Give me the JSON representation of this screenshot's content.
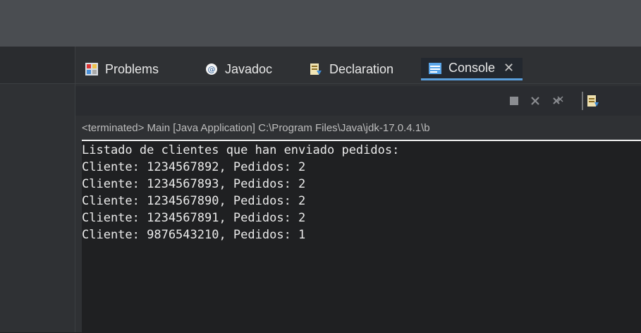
{
  "window": {
    "top_bar_color": "#4a4d51"
  },
  "tabs": [
    {
      "label": "Problems",
      "icon": "problems-icon"
    },
    {
      "label": "Javadoc",
      "icon": "javadoc-icon"
    },
    {
      "label": "Declaration",
      "icon": "declaration-icon"
    },
    {
      "label": "Console",
      "icon": "console-icon",
      "active": true,
      "close_label": "✕"
    }
  ],
  "toolbar": {
    "buttons": [
      "terminate-icon",
      "remove-icon",
      "remove-all-icon",
      "view-menu-icon"
    ]
  },
  "console": {
    "status": "<terminated> Main [Java Application] C:\\Program Files\\Java\\jdk-17.0.4.1\\b",
    "lines": [
      "Listado de clientes que han enviado pedidos:",
      "Cliente: 1234567892, Pedidos: 2",
      "Cliente: 1234567893, Pedidos: 2",
      "Cliente: 1234567890, Pedidos: 2",
      "Cliente: 1234567891, Pedidos: 2",
      "Cliente: 9876543210, Pedidos: 1"
    ]
  },
  "colors": {
    "background": "#1f2022",
    "panel": "#2f3134",
    "accent": "#5a9fdc",
    "text": "#eaeaea"
  }
}
